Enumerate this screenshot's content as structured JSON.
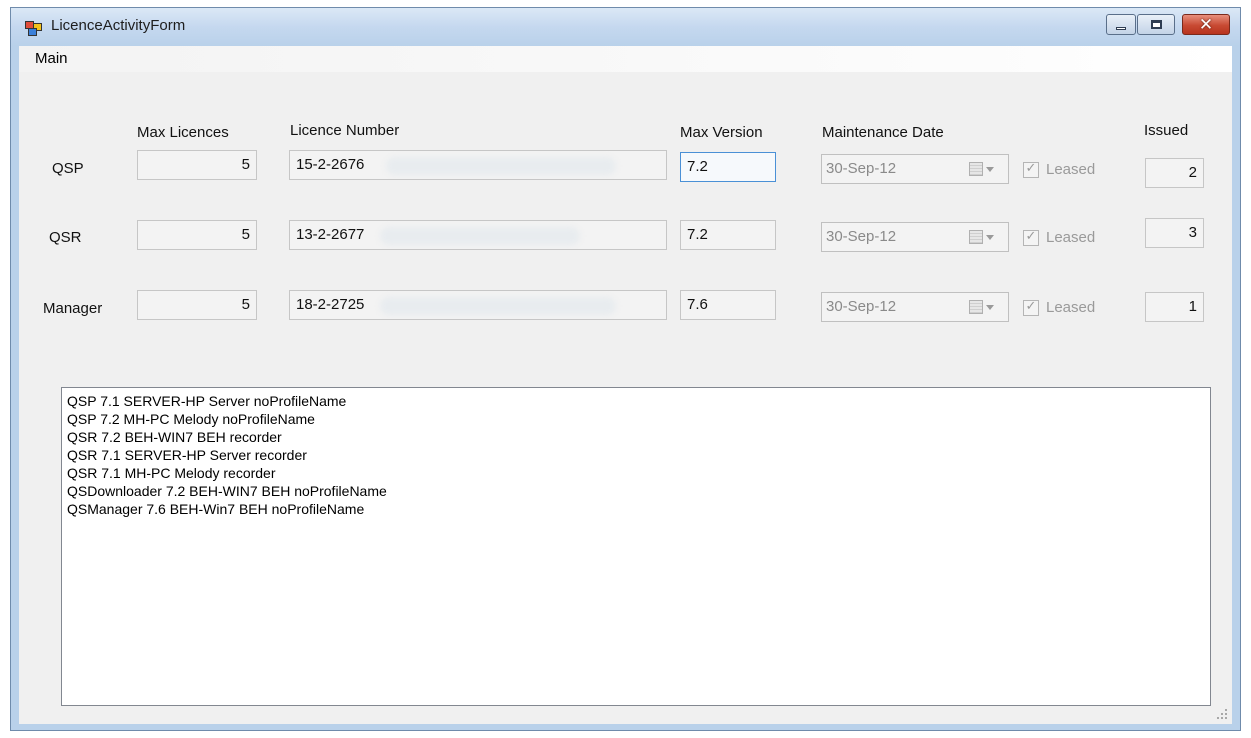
{
  "window": {
    "title": "LicenceActivityForm",
    "controls": {
      "minimize": "minimize",
      "maximize": "maximize",
      "close": "close"
    }
  },
  "menu": {
    "items": [
      "Main"
    ]
  },
  "headers": {
    "max_licences": "Max Licences",
    "licence_number": "Licence Number",
    "max_version": "Max Version",
    "maintenance_date": "Maintenance Date",
    "issued": "Issued"
  },
  "rows": [
    {
      "product": "QSP",
      "max_licences": "5",
      "licence_number": "15-2-2676",
      "max_version": "7.2",
      "maintenance_date": "30-Sep-12",
      "leased_label": "Leased",
      "leased_checked": true,
      "issued": "2"
    },
    {
      "product": "QSR",
      "max_licences": "5",
      "licence_number": "13-2-2677",
      "max_version": "7.2",
      "maintenance_date": "30-Sep-12",
      "leased_label": "Leased",
      "leased_checked": true,
      "issued": "3"
    },
    {
      "product": "Manager",
      "max_licences": "5",
      "licence_number": "18-2-2725",
      "max_version": "7.6",
      "maintenance_date": "30-Sep-12",
      "leased_label": "Leased",
      "leased_checked": true,
      "issued": "1"
    }
  ],
  "activity_list": [
    "QSP 7.1 SERVER-HP Server noProfileName",
    "QSP 7.2 MH-PC Melody noProfileName",
    "QSR 7.2 BEH-WIN7 BEH recorder",
    "QSR 7.1 SERVER-HP Server recorder",
    "QSR 7.1 MH-PC Melody recorder",
    "QSDownloader 7.2 BEH-WIN7 BEH noProfileName",
    "QSManager 7.6 BEH-Win7 BEH noProfileName"
  ],
  "colors": {
    "window_frame": "#b9d1ea",
    "client_bg": "#f0f0f0",
    "close_button": "#c84a33",
    "focus_border": "#4a90d6"
  }
}
